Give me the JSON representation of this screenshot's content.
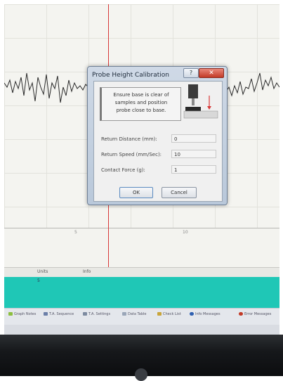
{
  "dialog": {
    "title": "Probe Height Calibration",
    "help_label": "?",
    "close_label": "✕",
    "instruction": [
      "Ensure base is clear of",
      "samples and position",
      "probe close to base."
    ],
    "fields": [
      {
        "label": "Return Distance (mm):",
        "value": "0"
      },
      {
        "label": "Return Speed (mm/Sec):",
        "value": "10"
      },
      {
        "label": "Contact Force (g):",
        "value": "1"
      }
    ],
    "ok_label": "OK",
    "cancel_label": "Cancel"
  },
  "graph": {
    "x_ticks": [
      "5",
      "10"
    ]
  },
  "table": {
    "columns": [
      "Units",
      "Info"
    ],
    "first_cell": "5"
  },
  "taskbar": {
    "items": [
      "Graph Notes",
      "T.A. Sequence",
      "T.A. Settings",
      "Data Table",
      "Check List",
      "Info Messages",
      "Error Messages"
    ]
  },
  "colors": {
    "teal_panel": "#1fc7b6",
    "cursor_line": "#d83838",
    "close_button": "#c23a26"
  }
}
